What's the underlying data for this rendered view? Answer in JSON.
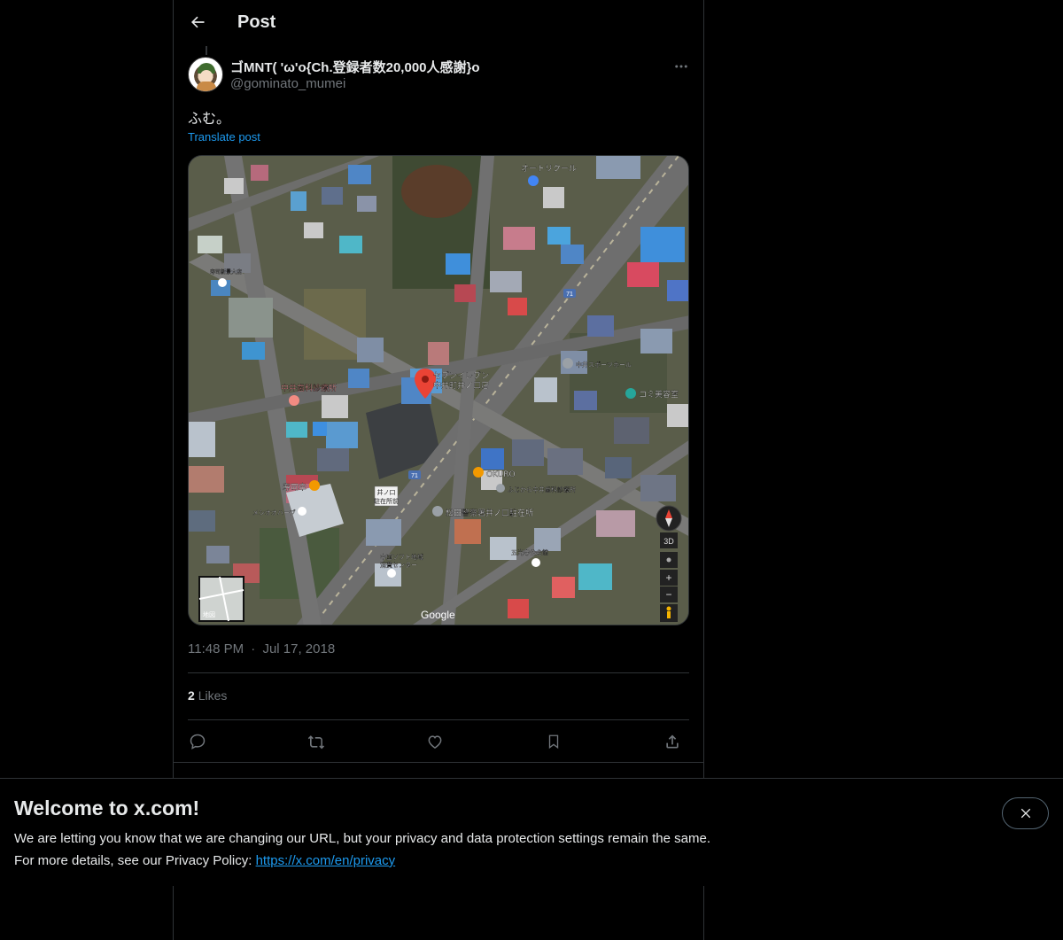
{
  "header": {
    "title": "Post"
  },
  "author": {
    "display_name": "ゴMNT( 'ω'o{Ch.登録者数20,000人感謝}o",
    "handle": "@gominato_mumei"
  },
  "post": {
    "text": "ふむ。",
    "translate_label": "Translate post",
    "time": "11:48 PM",
    "separator": "·",
    "date": "Jul 17, 2018"
  },
  "map": {
    "labels": {
      "top_shop": "オートリクール",
      "store_name": "セブンイレブン",
      "store_branch": "中井町井ノ口店",
      "sports": "中井スポーツホール",
      "salon": "コミ美容室",
      "clinic": "中井歯科診療所",
      "okuro": "OKURO",
      "dental2": "ふじから中井歯科診療所",
      "sushi": "寿司幸",
      "inoguchi": "井ノ口",
      "chuzai_mae": "駐在所前",
      "police": "松田警察署井ノ口駐在所",
      "meal": "メシオオハーブ",
      "center1": "中国ソフト地域",
      "center2": "消費センター",
      "park": "五光寺公会館",
      "road_num": "71",
      "compass_3d": "3D",
      "zoom_in": "+",
      "zoom_out": "−",
      "thumb_label": "地図",
      "left_top": "寿司新景大店",
      "google": "Google"
    }
  },
  "stats": {
    "likes_count": "2",
    "likes_label": "Likes"
  },
  "banner": {
    "title": "Welcome to x.com!",
    "line1": "We are letting you know that we are changing our URL, but your privacy and data protection settings remain the same.",
    "line2_prefix": "For more details, see our Privacy Policy: ",
    "link": "https://x.com/en/privacy"
  },
  "colors": {
    "accent": "#1d9bf0",
    "background": "#000000",
    "text": "#e7e9ea",
    "muted": "#71767b"
  },
  "icons": [
    "back-arrow-icon",
    "more-icon",
    "reply-icon",
    "repost-icon",
    "like-icon",
    "bookmark-icon",
    "share-icon",
    "close-icon",
    "map-pin-icon"
  ]
}
